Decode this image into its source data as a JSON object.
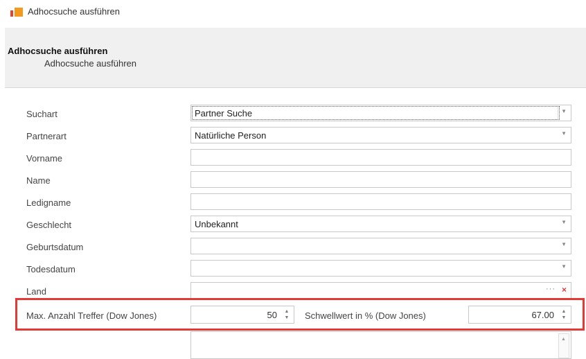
{
  "window": {
    "title": "Adhocsuche ausführen"
  },
  "header": {
    "title": "Adhocsuche ausführen",
    "subtitle": "Adhocsuche ausführen"
  },
  "form": {
    "fields": [
      {
        "label": "Suchart",
        "value": "Partner Suche",
        "type": "dropdown",
        "focused": true
      },
      {
        "label": "Partnerart",
        "value": "Natürliche Person",
        "type": "dropdown"
      },
      {
        "label": "Vorname",
        "value": "",
        "type": "text"
      },
      {
        "label": "Name",
        "value": "",
        "type": "text"
      },
      {
        "label": "Ledigname",
        "value": "",
        "type": "text"
      },
      {
        "label": "Geschlecht",
        "value": "Unbekannt",
        "type": "dropdown"
      },
      {
        "label": "Geburtsdatum",
        "value": "",
        "type": "dropdown"
      },
      {
        "label": "Todesdatum",
        "value": "",
        "type": "dropdown"
      },
      {
        "label": "Land",
        "value": "",
        "type": "lookup",
        "ellipsis": "···",
        "clear": "×"
      }
    ],
    "max_hits": {
      "label": "Max. Anzahl Treffer (Dow Jones)",
      "value": "50"
    },
    "threshold": {
      "label": "Schwellwert in % (Dow Jones)",
      "value": "67.00"
    }
  },
  "icons": {
    "dropdown": "chevron-down-icon",
    "spinner": "up-down-icon"
  },
  "colors": {
    "highlight": "#e53935",
    "app_icon_red": "#e8432e",
    "app_icon_orange": "#f39a1e"
  }
}
